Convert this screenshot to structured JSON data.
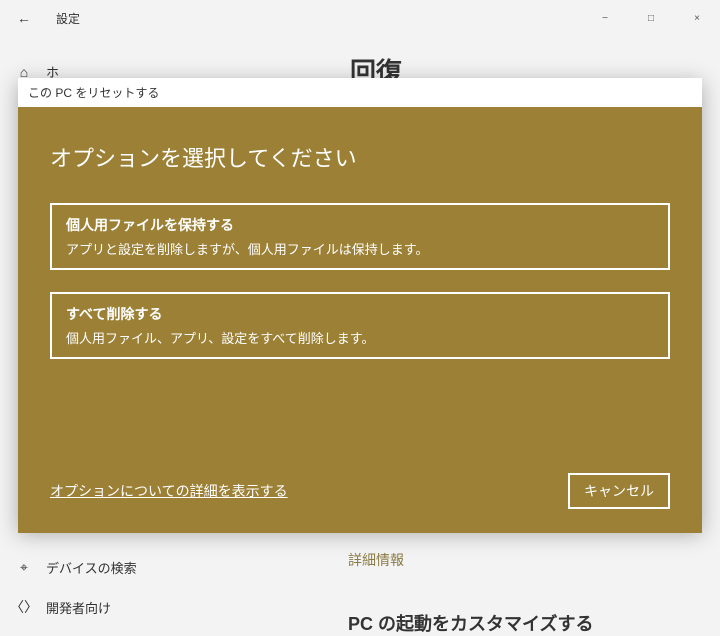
{
  "titlebar": {
    "back": "←",
    "title": "設定",
    "min": "−",
    "max": "□",
    "close": "×"
  },
  "sidebar": {
    "home": "ホ",
    "search": "デバイスの検索",
    "dev": "開発者向け"
  },
  "sidebarIcons": {
    "home": "⌂",
    "search": "⌖",
    "dev": "〈〉"
  },
  "content": {
    "heading": "回復",
    "detailLink": "詳細情報",
    "bootHead": "PC の起動をカスタマイズする"
  },
  "dialog": {
    "header": "この PC をリセットする",
    "title": "オプションを選択してください",
    "opt1Title": "個人用ファイルを保持する",
    "opt1Desc": "アプリと設定を削除しますが、個人用ファイルは保持します。",
    "opt2Title": "すべて削除する",
    "opt2Desc": "個人用ファイル、アプリ、設定をすべて削除します。",
    "moreLink": "オプションについての詳細を表示する",
    "cancel": "キャンセル"
  }
}
